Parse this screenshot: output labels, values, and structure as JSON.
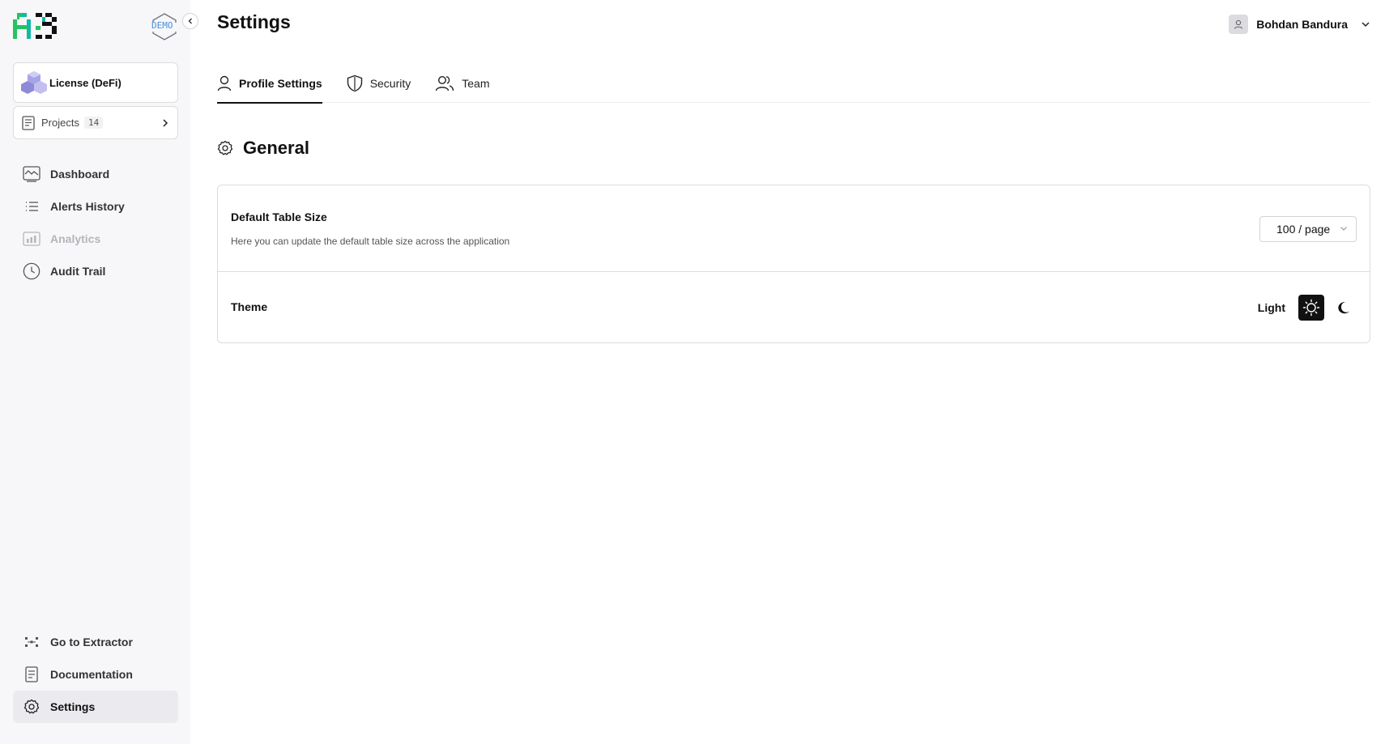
{
  "brand": {
    "demo_label": "DEMO"
  },
  "sidebar": {
    "license_label": "License (DeFi)",
    "projects": {
      "label": "Projects",
      "count": "14"
    },
    "nav_top": [
      {
        "label": "Dashboard",
        "icon": "chart-board-icon"
      },
      {
        "label": "Alerts History",
        "icon": "list-icon"
      },
      {
        "label": "Analytics",
        "icon": "bar-chart-icon",
        "disabled": true
      },
      {
        "label": "Audit Trail",
        "icon": "clock-icon"
      }
    ],
    "nav_bottom": [
      {
        "label": "Go to Extractor",
        "icon": "nodes-icon"
      },
      {
        "label": "Documentation",
        "icon": "document-icon"
      },
      {
        "label": "Settings",
        "icon": "gear-icon",
        "active": true
      }
    ]
  },
  "header": {
    "title": "Settings",
    "user_name": "Bohdan Bandura"
  },
  "tabs": [
    {
      "label": "Profile Settings",
      "active": true
    },
    {
      "label": "Security"
    },
    {
      "label": "Team"
    }
  ],
  "general": {
    "heading": "General",
    "table_size": {
      "title": "Default Table Size",
      "description": "Here you can update the default table size across the application",
      "value": "100 / page"
    },
    "theme": {
      "title": "Theme",
      "value": "Light"
    }
  },
  "colors": {
    "accent_green": "#2ecc71",
    "accent_teal": "#1abc9c",
    "dark": "#111111"
  }
}
